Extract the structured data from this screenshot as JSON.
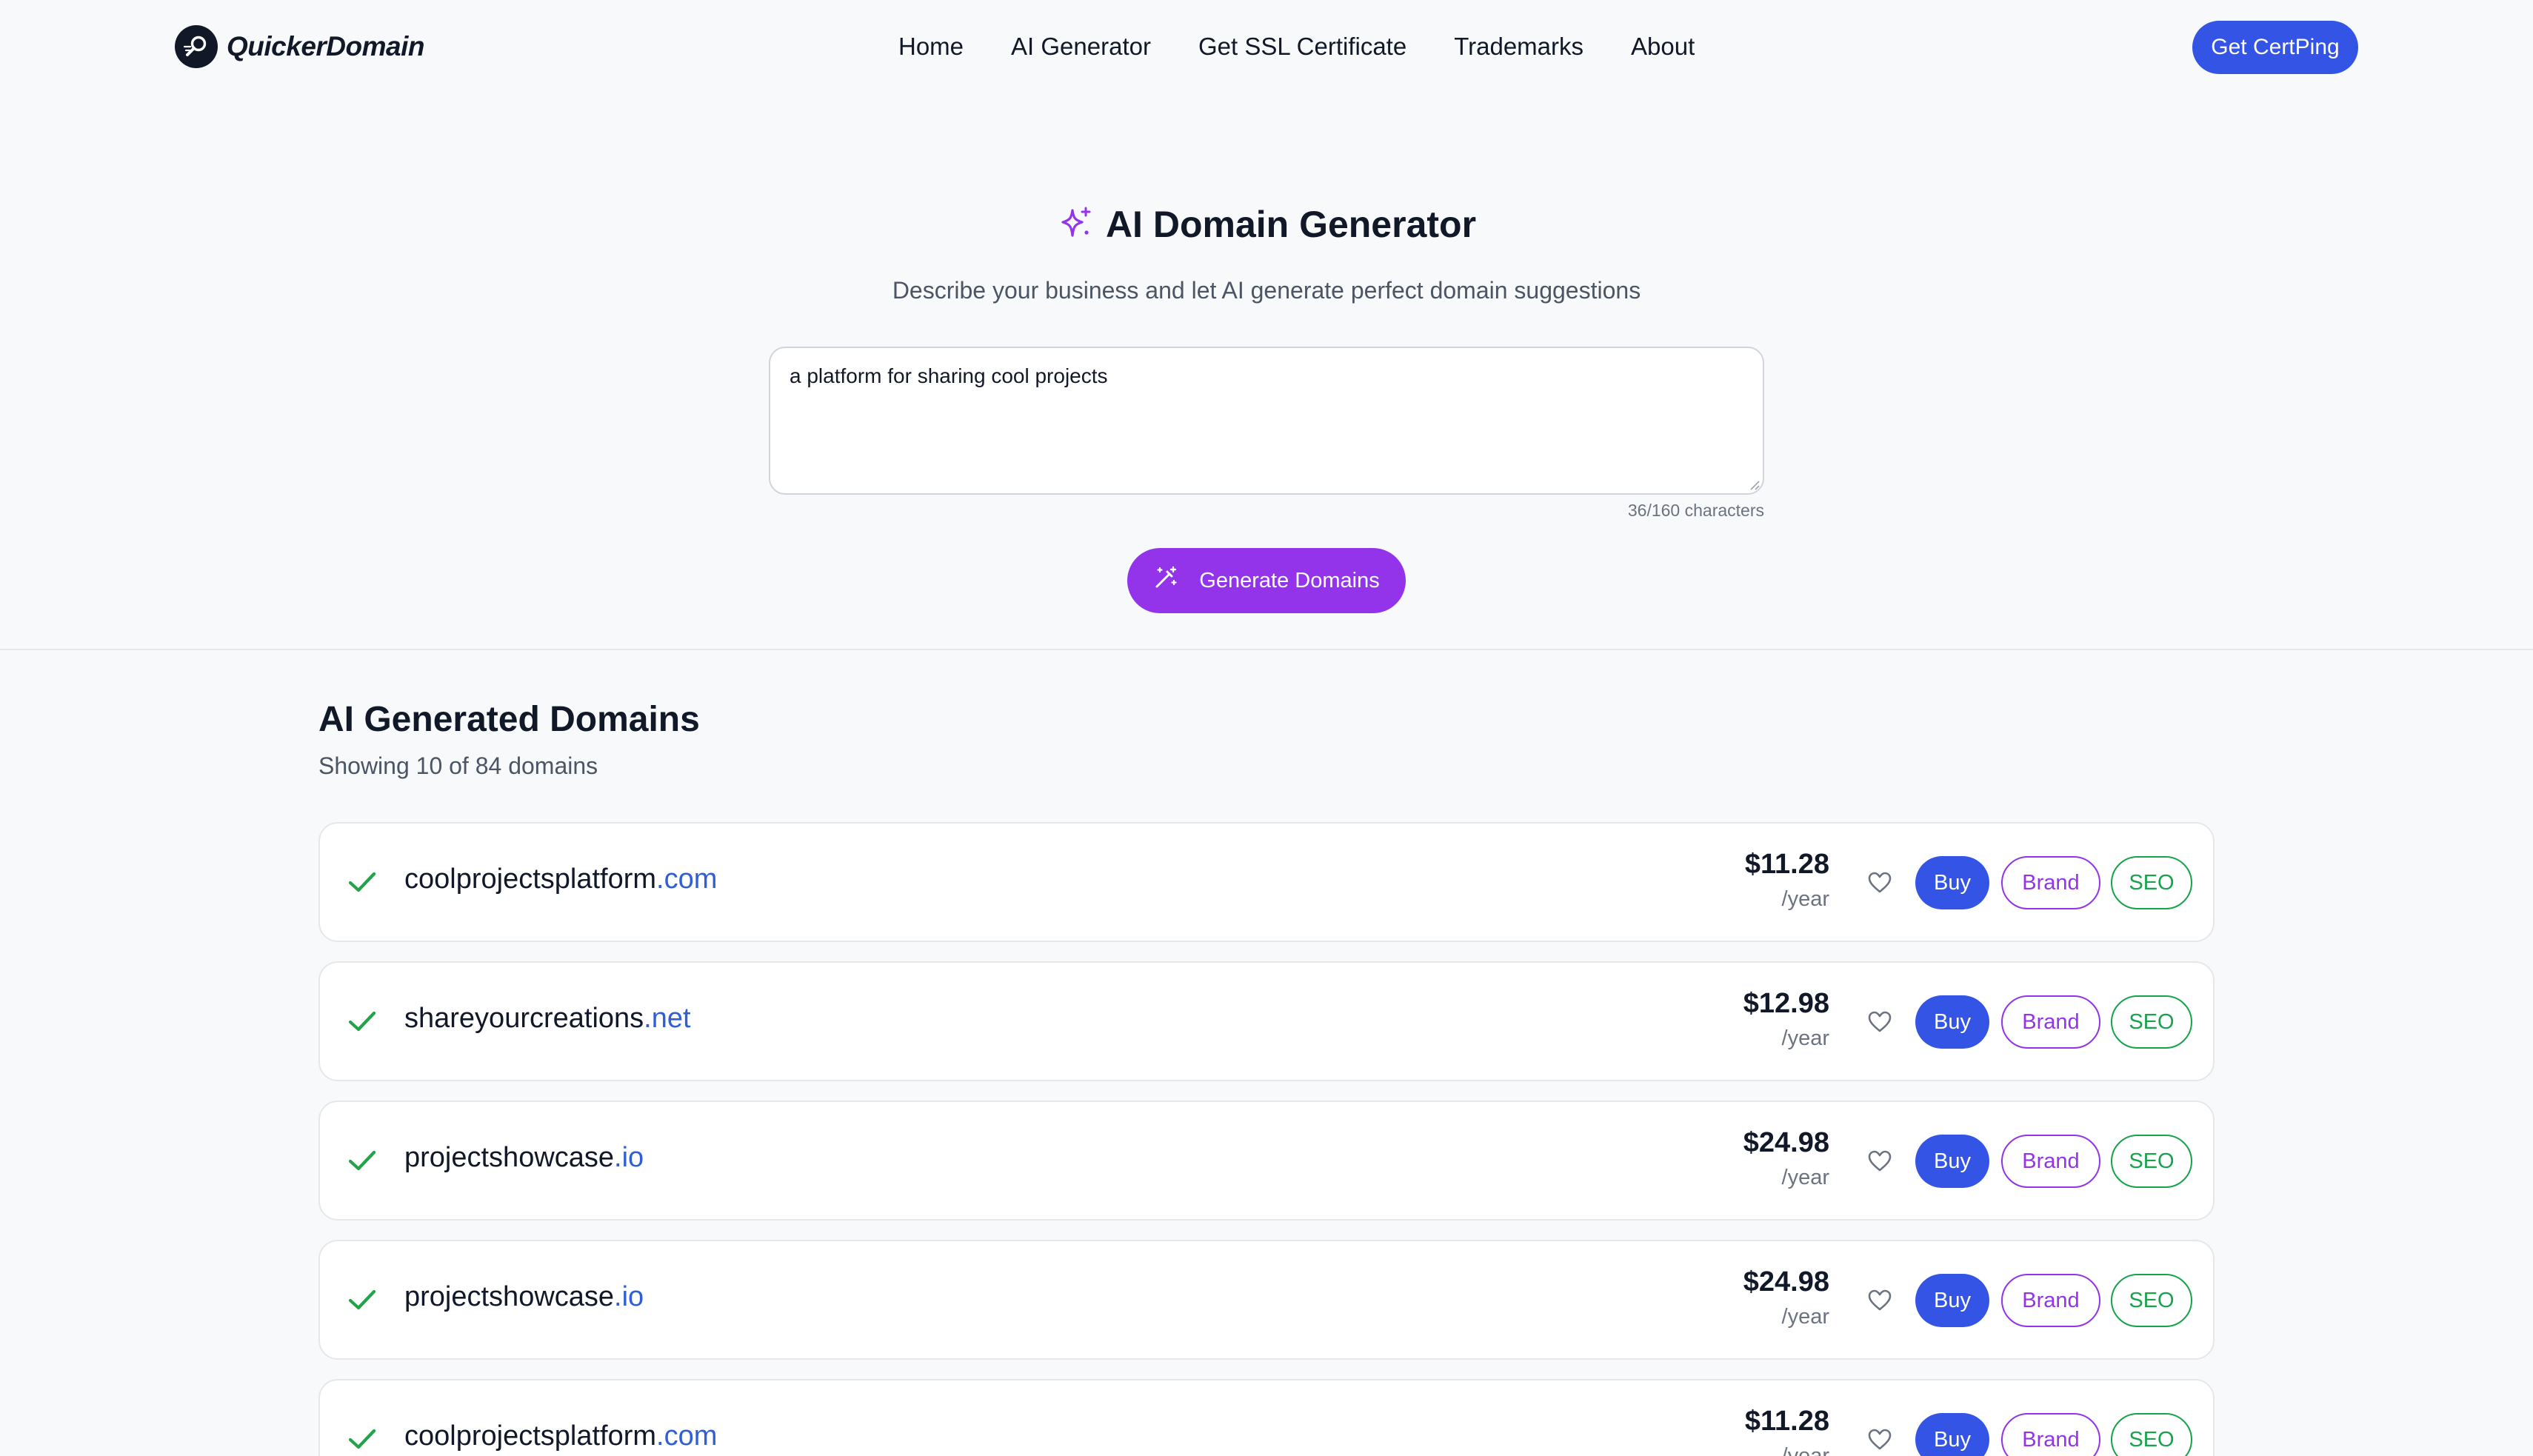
{
  "brand": {
    "name": "QuickerDomain",
    "logo_icon": "magnifier-logo-icon"
  },
  "nav": {
    "links": [
      "Home",
      "AI Generator",
      "Get SSL Certificate",
      "Trademarks",
      "About"
    ],
    "cta_label": "Get CertPing"
  },
  "hero": {
    "title": "AI Domain Generator",
    "title_icon": "sparkles-icon",
    "subtitle": "Describe your business and let AI generate perfect domain suggestions",
    "prompt_value": "a platform for sharing cool projects",
    "char_count": "36/160 characters",
    "generate_label": "Generate Domains",
    "generate_icon": "magic-wand-icon"
  },
  "results": {
    "title": "AI Generated Domains",
    "subtitle": "Showing 10 of 84 domains",
    "per_year": "/year",
    "buy_label": "Buy",
    "brand_label": "Brand",
    "seo_label": "SEO",
    "domains": [
      {
        "name": "coolprojectsplatform",
        "tld": ".com",
        "price": "$11.28"
      },
      {
        "name": "shareyourcreations",
        "tld": ".net",
        "price": "$12.98"
      },
      {
        "name": "projectshowcase",
        "tld": ".io",
        "price": "$24.98"
      },
      {
        "name": "projectshowcase",
        "tld": ".io",
        "price": "$24.98"
      },
      {
        "name": "coolprojectsplatform",
        "tld": ".com",
        "price": "$11.28"
      }
    ]
  },
  "colors": {
    "primary_blue": "#3454e6",
    "purple": "#9333ea",
    "green": "#16a34a",
    "tld_blue": "#2f5fd6"
  }
}
